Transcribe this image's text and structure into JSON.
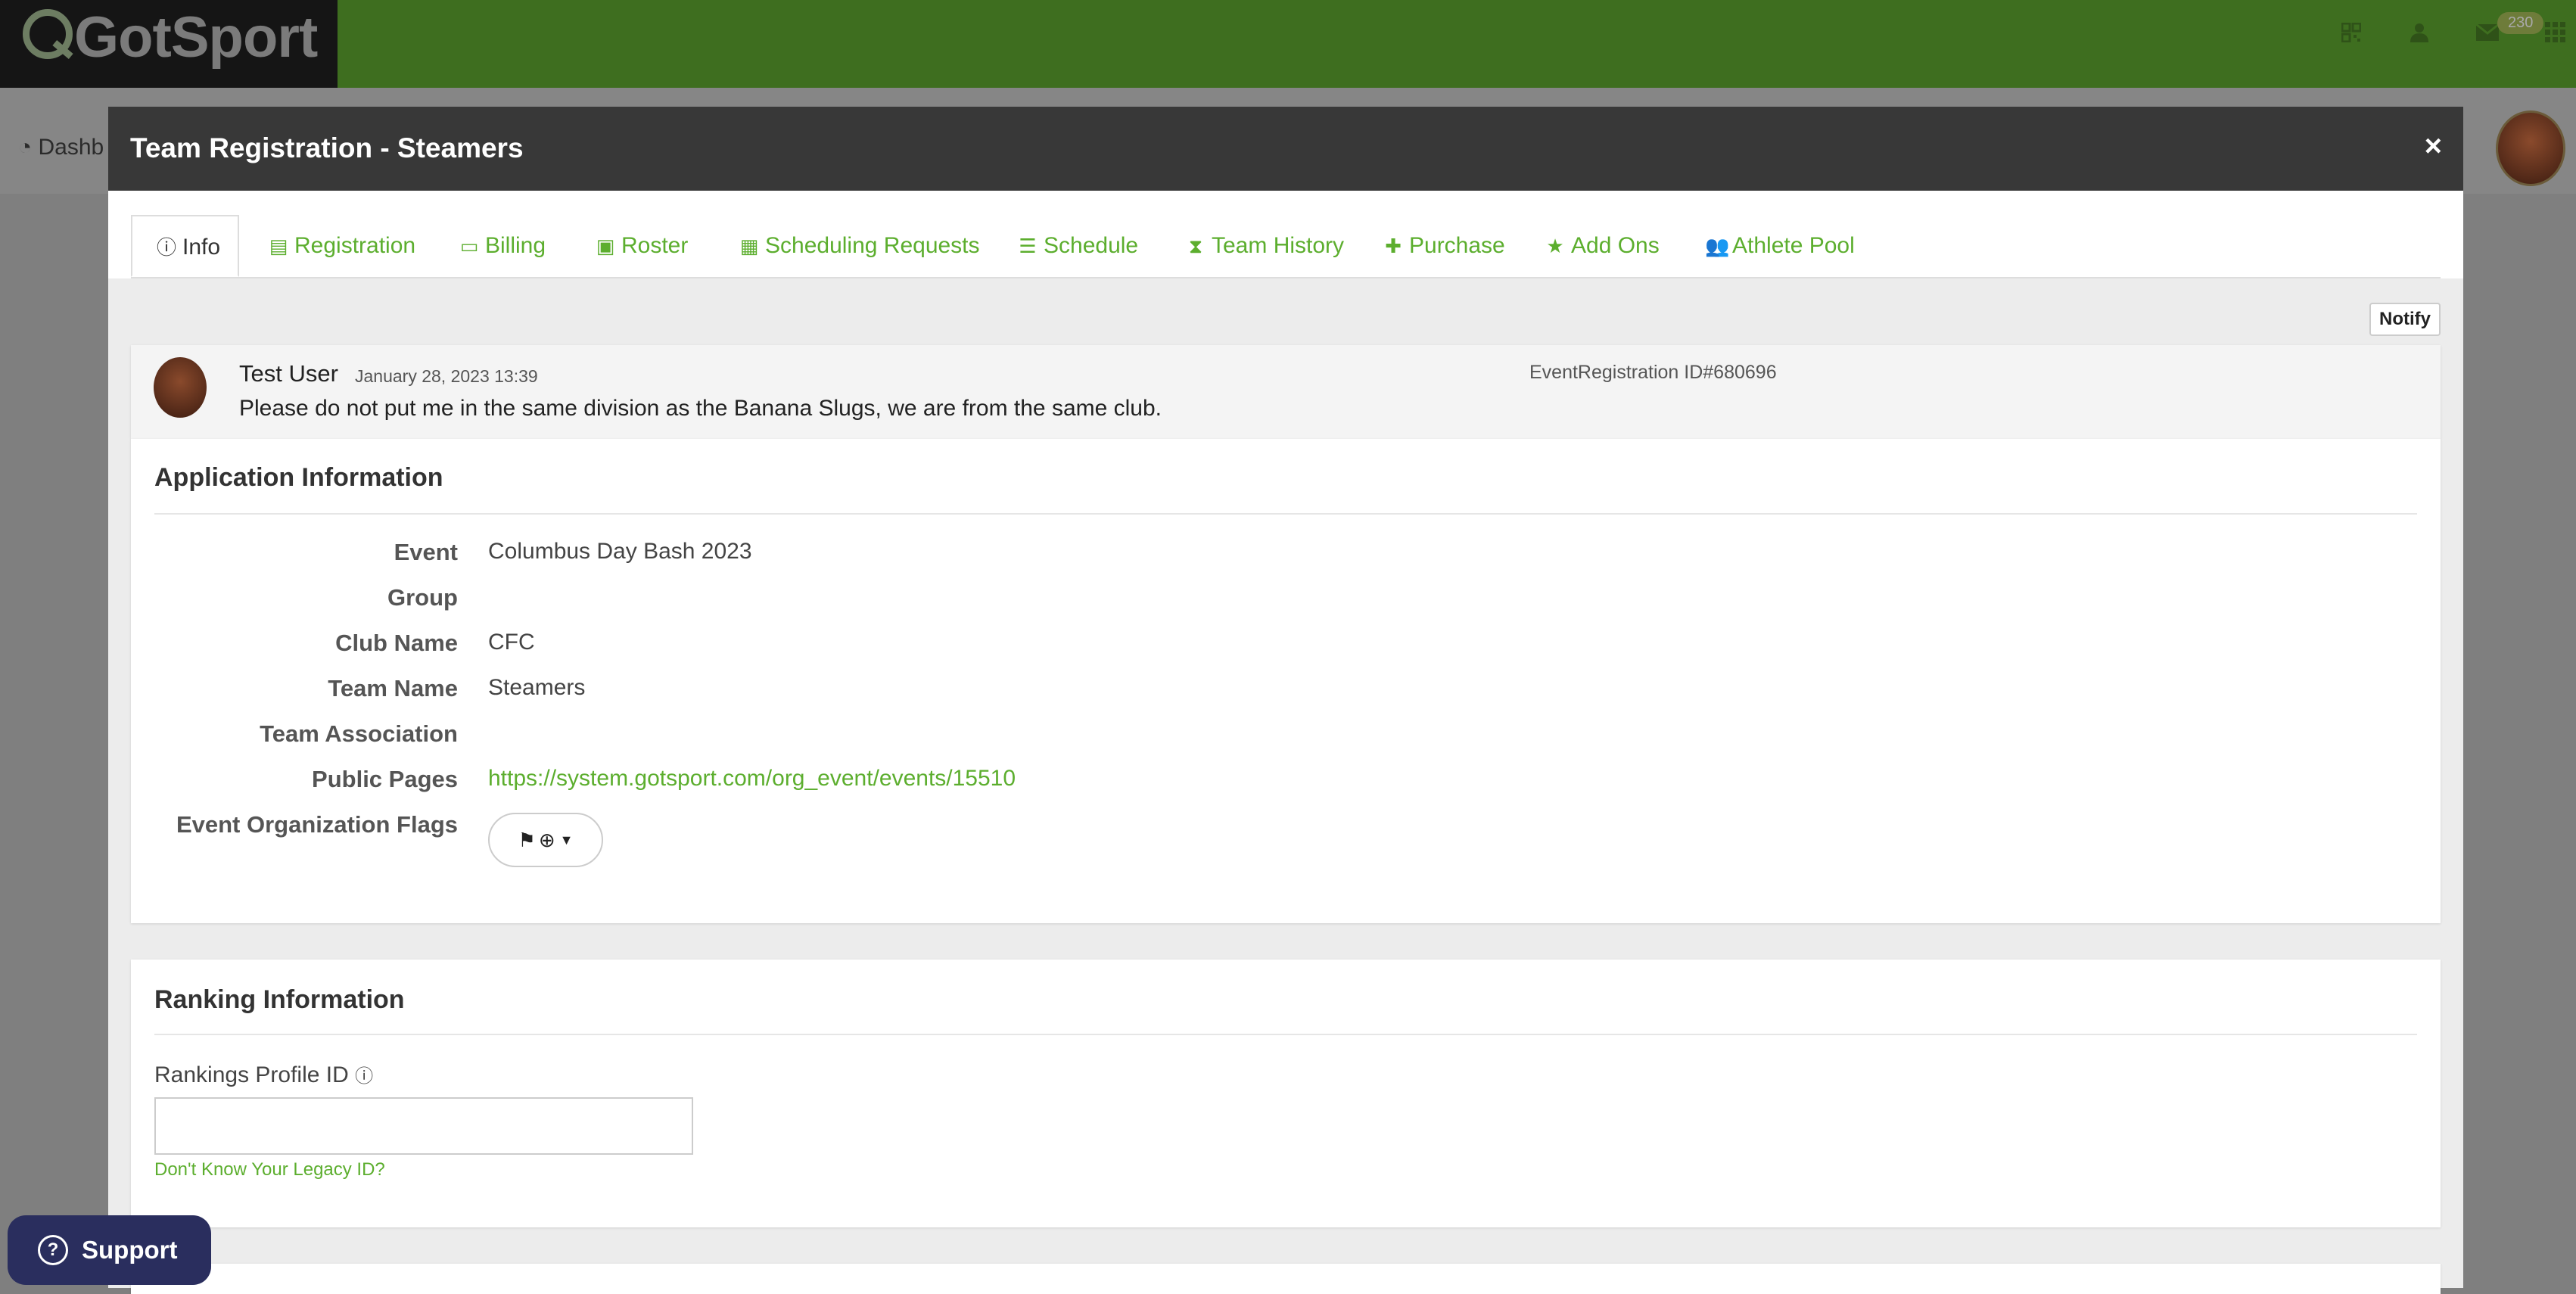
{
  "app": {
    "logo_text": "GotSport"
  },
  "topbar": {
    "mail_badge": "230"
  },
  "background": {
    "dashboard_label": "Dashb"
  },
  "modal": {
    "title": "Team Registration - Steamers",
    "close_label": "×",
    "tabs": [
      {
        "label": "Info",
        "icon": "info-icon"
      },
      {
        "label": "Registration",
        "icon": "list-icon"
      },
      {
        "label": "Billing",
        "icon": "credit-card-icon"
      },
      {
        "label": "Roster",
        "icon": "id-card-icon"
      },
      {
        "label": "Scheduling Requests",
        "icon": "calendar-icon"
      },
      {
        "label": "Schedule",
        "icon": "list-alt-icon"
      },
      {
        "label": "Team History",
        "icon": "hourglass-icon"
      },
      {
        "label": "Purchase",
        "icon": "plus-icon"
      },
      {
        "label": "Add Ons",
        "icon": "star-icon"
      },
      {
        "label": "Athlete Pool",
        "icon": "users-icon"
      }
    ],
    "notify_label": "Notify"
  },
  "message": {
    "user": "Test User",
    "date": "January 28, 2023 13:39",
    "registration_id": "EventRegistration ID#680696",
    "text": "Please do not put me in the same division as the Banana Slugs, we are from the same club."
  },
  "application": {
    "title": "Application Information",
    "fields": [
      {
        "label": "Event",
        "value": "Columbus Day Bash 2023"
      },
      {
        "label": "Group",
        "value": ""
      },
      {
        "label": "Club Name",
        "value": "CFC"
      },
      {
        "label": "Team Name",
        "value": "Steamers"
      },
      {
        "label": "Team Association",
        "value": ""
      },
      {
        "label": "Public Pages",
        "value": "https://system.gotsport.com/org_event/events/15510"
      },
      {
        "label": "Event Organization Flags",
        "value": ""
      }
    ]
  },
  "ranking": {
    "title": "Ranking Information",
    "profile_label": "Rankings Profile ID",
    "profile_value": "",
    "legacy_link": "Don't Know Your Legacy ID?"
  },
  "support": {
    "label": "Support"
  }
}
